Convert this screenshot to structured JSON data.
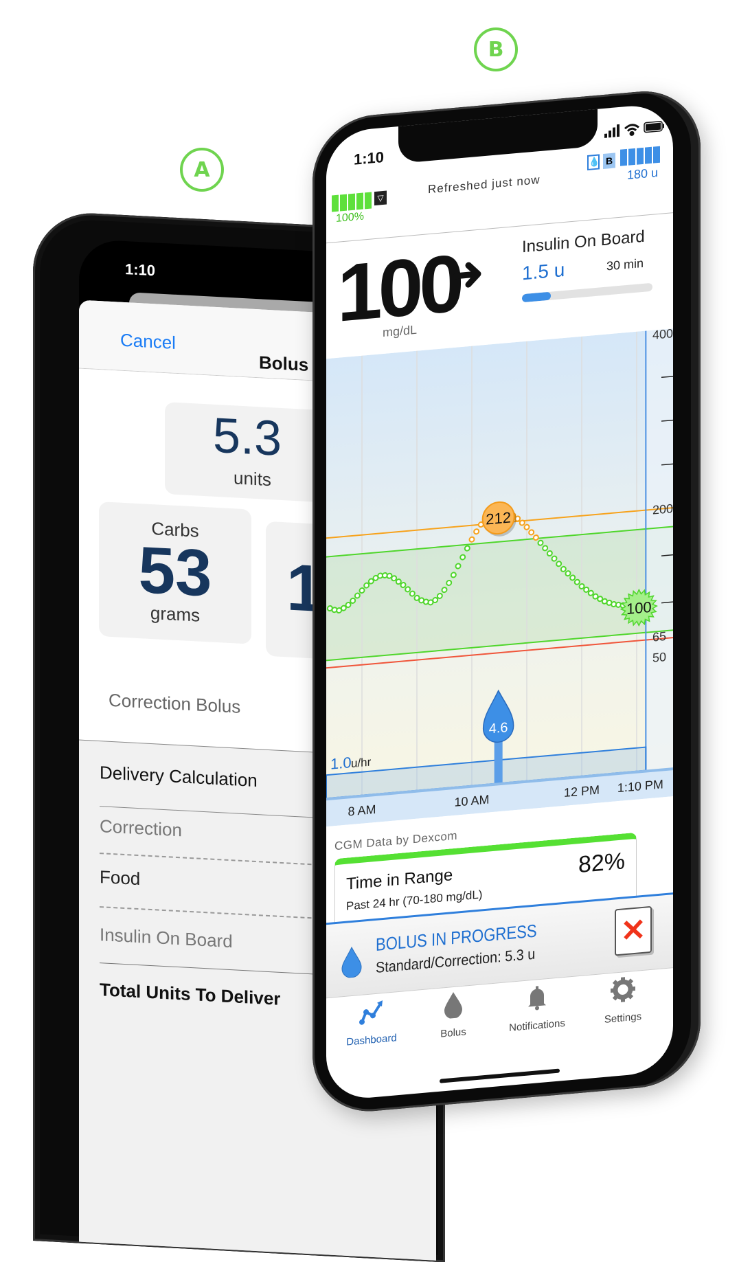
{
  "badges": {
    "a": "A",
    "b": "B"
  },
  "colors": {
    "accent_green": "#6fd44f",
    "app_blue": "#2f7fdc",
    "navy": "#17365d",
    "high_orange": "#f7a21b",
    "range_green": "#4fd62b",
    "low_red": "#f0553a"
  },
  "phone_a": {
    "status_time": "1:10",
    "nav": {
      "cancel": "Cancel",
      "title": "Bolus"
    },
    "total": {
      "value": "5.3",
      "unit": "units"
    },
    "carbs": {
      "label": "Carbs",
      "value": "53",
      "unit": "grams"
    },
    "partial_card_value": "1",
    "correction_bolus": "Correction Bolus",
    "delivery_calculation": "Delivery Calculation",
    "rows": [
      "Correction",
      "Food",
      "Insulin On Board"
    ],
    "total_units": "Total Units To Deliver"
  },
  "phone_b": {
    "status_time": "1:10",
    "transmitter_battery": "100%",
    "refreshed": "Refreshed just now",
    "pump_badge": "B",
    "reservoir": "180 u",
    "glucose": {
      "value": "100",
      "unit": "mg/dL",
      "trend": "steady-right-arrow"
    },
    "iob": {
      "title": "Insulin On Board",
      "value": "1.5 u",
      "time": "30 min",
      "progress_percent": 22
    },
    "cgm_source": "CGM Data by Dexcom",
    "time_in_range": {
      "title": "Time in Range",
      "subtitle": "Past 24 hr (70-180 mg/dL)",
      "value": "82%"
    },
    "bolus_banner": {
      "title": "BOLUS IN PROGRESS",
      "detail": "Standard/Correction: 5.3 u"
    },
    "tabs": [
      {
        "label": "Dashboard",
        "icon": "dashboard-chart-icon",
        "active": true
      },
      {
        "label": "Bolus",
        "icon": "drop-icon",
        "active": false
      },
      {
        "label": "Notifications",
        "icon": "bell-icon",
        "active": false
      },
      {
        "label": "Settings",
        "icon": "gear-icon",
        "active": false
      }
    ]
  },
  "chart_data": {
    "type": "scatter",
    "y_tick_labels": [
      "400",
      "200",
      "65",
      "50"
    ],
    "x_tick_labels": [
      {
        "label": "8 AM",
        "time": "8:00"
      },
      {
        "label": "10 AM",
        "time": "10:00"
      },
      {
        "label": "12 PM",
        "time": "12:00"
      },
      {
        "label": "1:10 PM",
        "time": "13:10"
      }
    ],
    "thresholds": {
      "high": 200,
      "target_high": 180,
      "target_low": 70,
      "low": 65
    },
    "glucose_start": "7:25",
    "glucose_interval_min": 5,
    "glucose_values": [
      125,
      123,
      122,
      124,
      127,
      131,
      136,
      141,
      146,
      150,
      153,
      155,
      155,
      154,
      151,
      147,
      143,
      138,
      133,
      128,
      125,
      123,
      122,
      124,
      128,
      134,
      141,
      149,
      158,
      167,
      176,
      185,
      193,
      200,
      205,
      209,
      211,
      212,
      212,
      210,
      207,
      203,
      198,
      193,
      187,
      181,
      175,
      169,
      163,
      157,
      151,
      145,
      140,
      135,
      130,
      125,
      121,
      117,
      113,
      110,
      107,
      105,
      103,
      102,
      101,
      100,
      100,
      100,
      100,
      100
    ],
    "peak_label": {
      "time": "10:29",
      "value": "212"
    },
    "current_label": {
      "time": "13:10",
      "value": "100"
    },
    "basal": {
      "label_value": "1.0",
      "label_unit": "u/hr"
    },
    "bolus_marker": {
      "time": "10:29",
      "value": "4.6"
    },
    "now": "13:10"
  }
}
